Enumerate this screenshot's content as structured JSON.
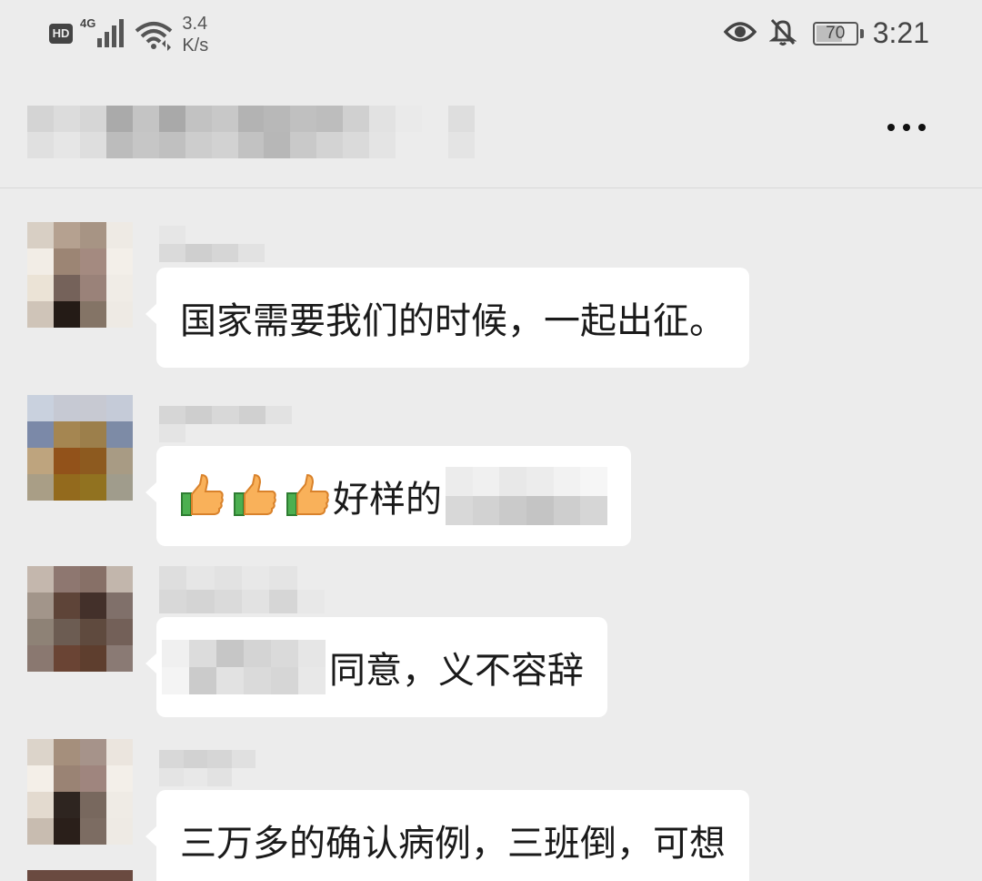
{
  "status_bar": {
    "hd_label": "HD",
    "network_label": "4G",
    "speed_value": "3.4",
    "speed_unit": "K/s",
    "battery_percent": "70",
    "battery_level": 0.7,
    "time": "3:21",
    "icons": [
      "hd-icon",
      "signal-icon",
      "wifi-icon",
      "eye-icon",
      "bell-off-icon",
      "battery-icon"
    ]
  },
  "header": {
    "title": "",
    "more_icon": "more-icon"
  },
  "messages": [
    {
      "sender": "",
      "text": "国家需要我们的时候，一起出征。"
    },
    {
      "sender": "",
      "prefix_icons": [
        "thumbs-up-icon",
        "thumbs-up-icon",
        "thumbs-up-icon"
      ],
      "text": "好样的"
    },
    {
      "sender": "",
      "text": "同意，义不容辞"
    },
    {
      "sender": "",
      "text": "三万多的确认病例，三班倒，可想"
    }
  ],
  "colors": {
    "background": "#ececec",
    "bubble": "#ffffff",
    "text": "#1a1a1a",
    "status_icons": "#444444"
  }
}
